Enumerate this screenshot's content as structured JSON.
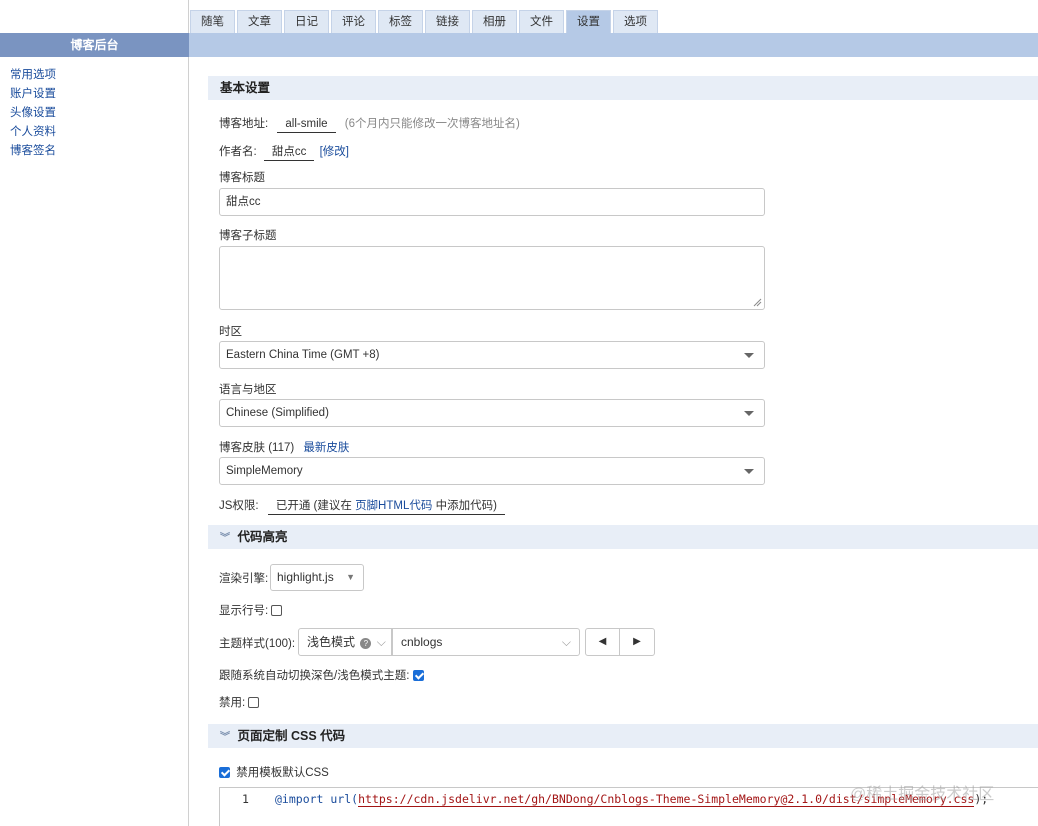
{
  "tabs": [
    "随笔",
    "文章",
    "日记",
    "评论",
    "标签",
    "链接",
    "相册",
    "文件",
    "设置",
    "选项"
  ],
  "active_tab": "设置",
  "sidebar": {
    "title": "博客后台",
    "items": [
      "常用选项",
      "账户设置",
      "头像设置",
      "个人资料",
      "博客签名"
    ]
  },
  "basic": {
    "header": "基本设置",
    "blog_address_label": "博客地址:",
    "blog_address_value": "all-smile",
    "blog_address_note": "(6个月内只能修改一次博客地址名)",
    "author_label": "作者名:",
    "author_value": "甜点cc",
    "author_modify": "[修改]",
    "title_label": "博客标题",
    "title_value": "甜点cc",
    "subtitle_label": "博客子标题",
    "subtitle_value": "",
    "timezone_label": "时区",
    "timezone_value": "Eastern China Time (GMT +8)",
    "language_label": "语言与地区",
    "language_value": "Chinese (Simplified)",
    "skin_label": "博客皮肤",
    "skin_count": "(117)",
    "skin_latest": "最新皮肤",
    "skin_value": "SimpleMemory",
    "js_label": "JS权限:",
    "js_status": "已开通 (建议在 ",
    "js_link": "页脚HTML代码",
    "js_tail": " 中添加代码)"
  },
  "highlight": {
    "header": "代码高亮",
    "engine_label": "渲染引擎:",
    "engine_value": "highlight.js",
    "line_numbers_label": "显示行号:",
    "line_numbers_checked": false,
    "theme_label": "主题样式(100):",
    "theme_mode": "浅色模式",
    "theme_value": "cnblogs",
    "follow_system_label": "跟随系统自动切换深色/浅色模式主题:",
    "follow_system_checked": true,
    "disable_label": "禁用:",
    "disable_checked": false
  },
  "css": {
    "header": "页面定制 CSS 代码",
    "disable_default_label": "禁用模板默认CSS",
    "disable_default_checked": true,
    "line_number": "1",
    "code_keyword": "@import",
    "code_func": "url(",
    "code_url": "https://cdn.jsdelivr.net/gh/BNDong/Cnblogs-Theme-SimpleMemory@2.1.0/dist/simpleMemory.css",
    "code_tail": ");"
  },
  "watermark": "@稀土掘金技术社区",
  "colors": {
    "accent": "#1a4c9c",
    "sidebar_title_bg": "#7a94c1",
    "topbar_bg": "#b5c9e6",
    "section_bg": "#e8eef7",
    "checkbox_checked": "#1a6ed8"
  }
}
